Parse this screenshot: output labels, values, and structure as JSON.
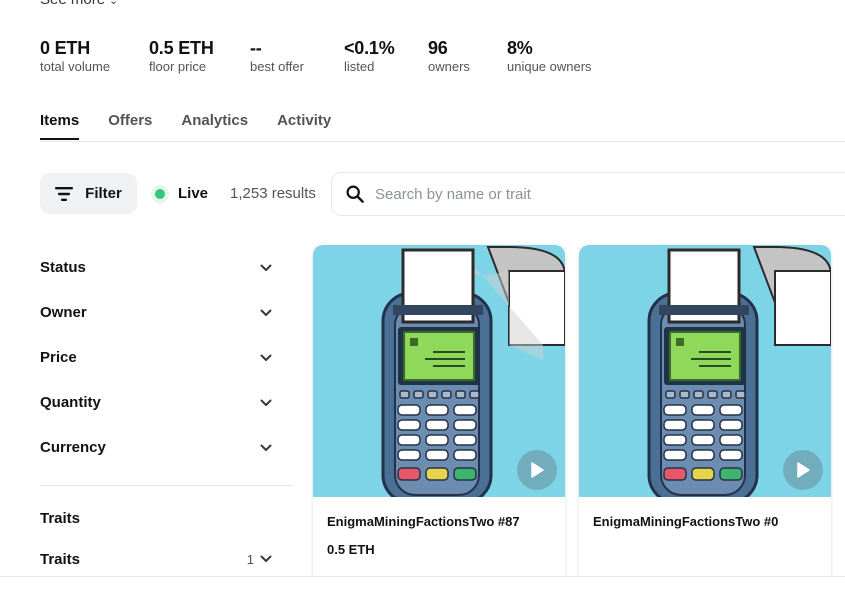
{
  "header": {
    "see_more": "See more"
  },
  "stats": [
    {
      "value": "0 ETH",
      "label": "total volume"
    },
    {
      "value": "0.5 ETH",
      "label": "floor price"
    },
    {
      "value": "--",
      "label": "best offer"
    },
    {
      "value": "<0.1%",
      "label": "listed"
    },
    {
      "value": "96",
      "label": "owners"
    },
    {
      "value": "8%",
      "label": "unique owners"
    }
  ],
  "tabs": [
    {
      "label": "Items",
      "active": true
    },
    {
      "label": "Offers",
      "active": false
    },
    {
      "label": "Analytics",
      "active": false
    },
    {
      "label": "Activity",
      "active": false
    }
  ],
  "toolbar": {
    "filter_label": "Filter",
    "live_label": "Live",
    "results": "1,253 results",
    "search_placeholder": "Search by name or trait"
  },
  "sidebar": {
    "filters": [
      {
        "label": "Status"
      },
      {
        "label": "Owner"
      },
      {
        "label": "Price"
      },
      {
        "label": "Quantity"
      },
      {
        "label": "Currency"
      }
    ],
    "traits_heading": "Traits",
    "traits_row": {
      "label": "Traits",
      "count": "1"
    }
  },
  "items": [
    {
      "name": "EnigmaMiningFactionsTwo #87",
      "price": "0.5 ETH"
    },
    {
      "name": "EnigmaMiningFactionsTwo #0",
      "price": ""
    }
  ],
  "colors": {
    "accent_live": "#34c77b",
    "card_bg": "#7dd4e6",
    "terminal_body": "#4a7096",
    "screen": "#8ed85a"
  },
  "icons": {
    "filter": "filter-icon",
    "search": "search-icon",
    "chevron": "chevron-down-icon",
    "play": "play-icon"
  }
}
